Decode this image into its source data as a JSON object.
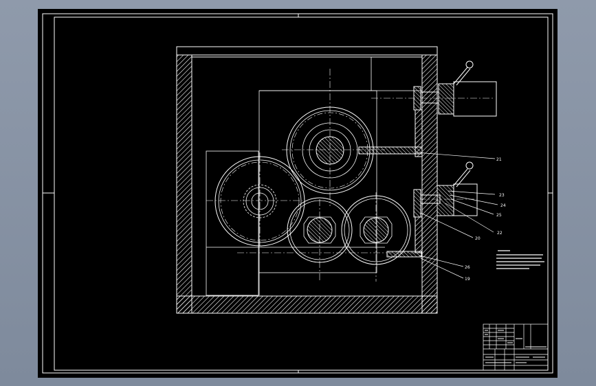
{
  "part_labels": {
    "p21": "21",
    "p23": "23",
    "p24": "24",
    "p25": "25",
    "p22": "22",
    "p20": "20",
    "p26": "26",
    "p19": "19"
  },
  "colors": {
    "background": "#000000",
    "lines": "#ffffff",
    "cad_chrome": "#8c97a8"
  }
}
